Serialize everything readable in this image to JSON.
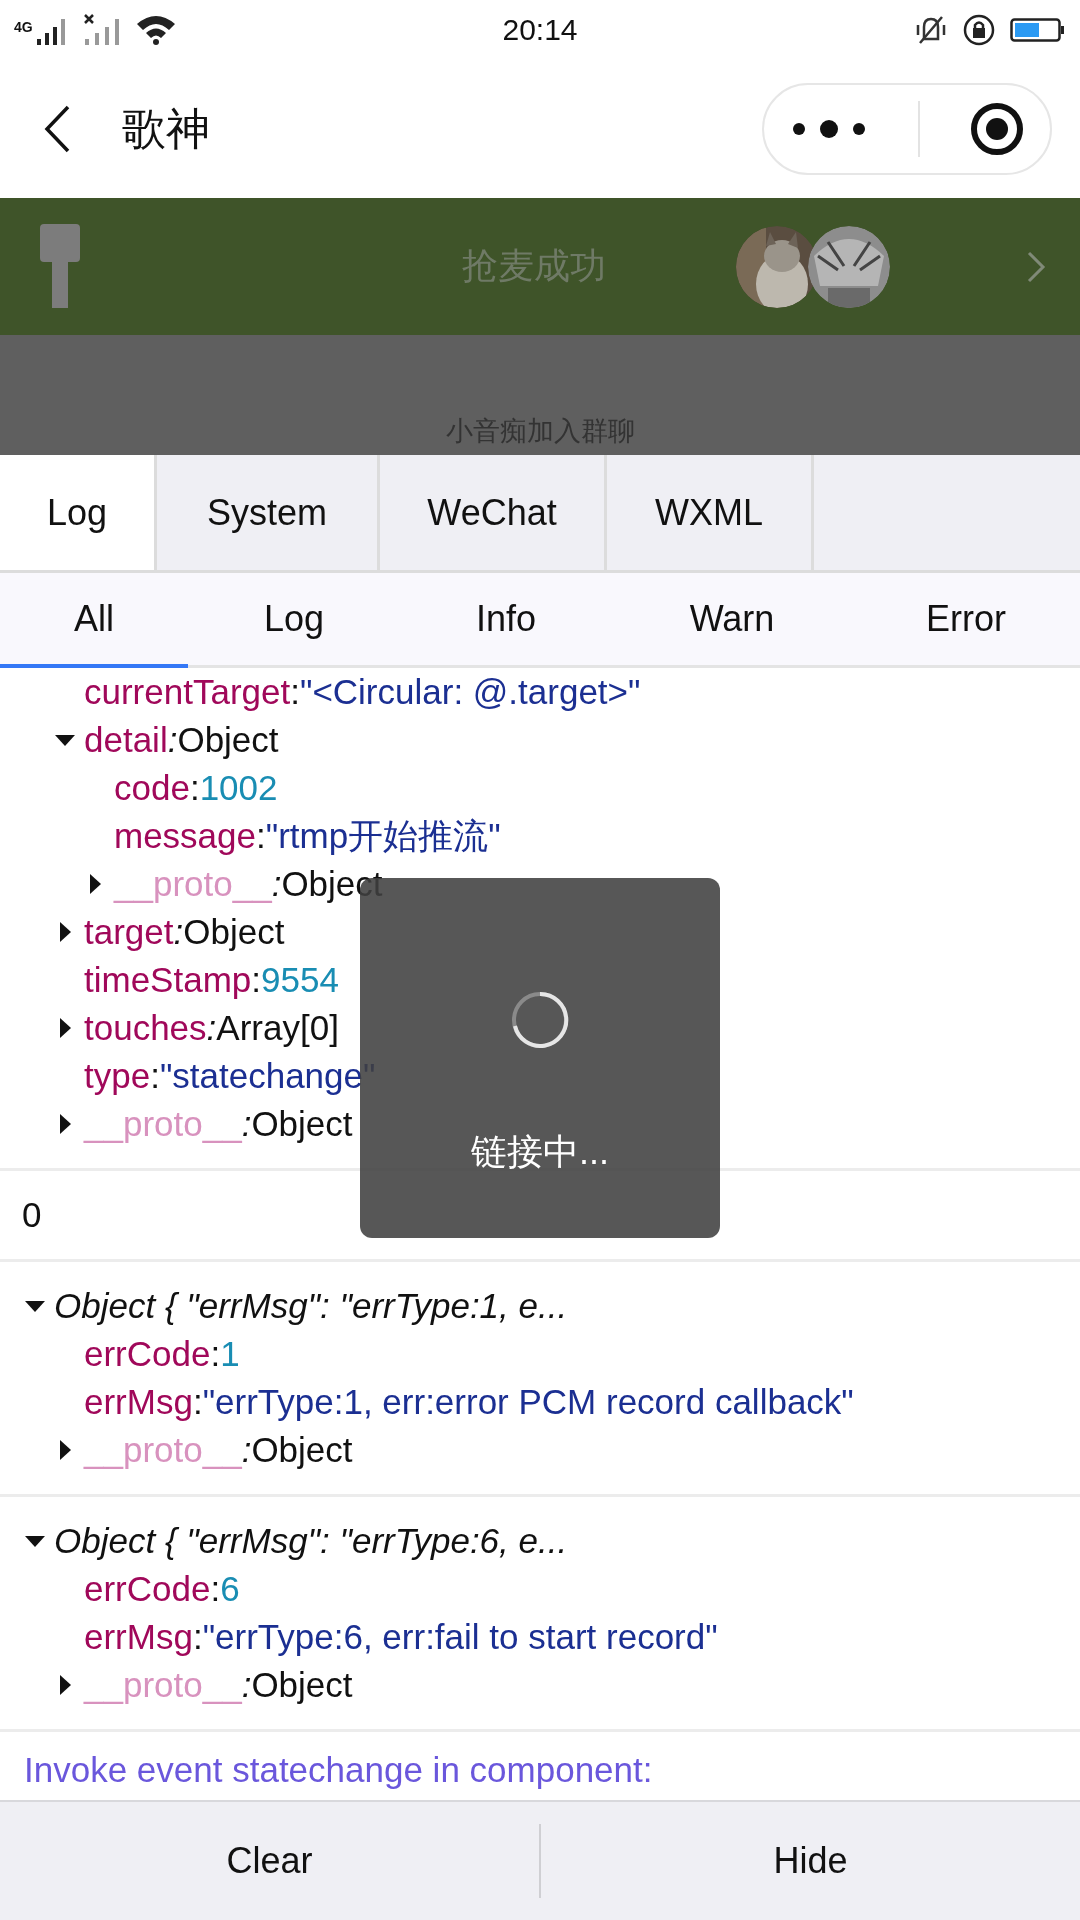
{
  "status_bar": {
    "network": "4G",
    "time": "20:14"
  },
  "nav": {
    "title": "歌神"
  },
  "banner": {
    "title": "抢麦成功"
  },
  "notice": "小音痴加入群聊",
  "tabs": [
    {
      "label": "Log",
      "selected": true
    },
    {
      "label": "System",
      "selected": false
    },
    {
      "label": "WeChat",
      "selected": false
    },
    {
      "label": "WXML",
      "selected": false
    }
  ],
  "filters": [
    {
      "label": "All",
      "selected": true
    },
    {
      "label": "Log",
      "selected": false
    },
    {
      "label": "Info",
      "selected": false
    },
    {
      "label": "Warn",
      "selected": false
    },
    {
      "label": "Error",
      "selected": false
    }
  ],
  "log_entries": [
    {
      "kind": "tree",
      "children": [
        {
          "key": "currentTarget",
          "sep": ":",
          "value": "\"<Circular: @.target>\"",
          "kind": "string"
        },
        {
          "key": "detail",
          "sep": ":",
          "value": "Object",
          "kind": "object",
          "expanded": true,
          "children": [
            {
              "key": "code",
              "sep": ":",
              "value": "1002",
              "kind": "number"
            },
            {
              "key": "message",
              "sep": ":",
              "value": "\"rtmp开始推流\"",
              "kind": "string"
            },
            {
              "key": "__proto__",
              "sep": ":",
              "value": "Object",
              "kind": "proto",
              "expanded": false
            }
          ]
        },
        {
          "key": "target",
          "sep": ":",
          "value": "Object",
          "kind": "object",
          "expanded": false
        },
        {
          "key": "timeStamp",
          "sep": ":",
          "value": "9554",
          "kind": "number"
        },
        {
          "key": "touches",
          "sep": ":",
          "value": "Array[0]",
          "kind": "object",
          "expanded": false
        },
        {
          "key": "type",
          "sep": ":",
          "value": "\"statechange\"",
          "kind": "string"
        },
        {
          "key": "__proto__",
          "sep": ":",
          "value": "Object",
          "kind": "proto",
          "expanded": false
        }
      ]
    },
    {
      "kind": "plain",
      "text": "0"
    },
    {
      "kind": "object",
      "summary": "Object { \"errMsg\": \"errType:1, e...",
      "expanded": true,
      "children": [
        {
          "key": "errCode",
          "sep": ":",
          "value": "1",
          "kind": "number"
        },
        {
          "key": "errMsg",
          "sep": ":",
          "value": "\"errType:1, err:error PCM record callback\"",
          "kind": "string"
        },
        {
          "key": "__proto__",
          "sep": ":",
          "value": "Object",
          "kind": "proto",
          "expanded": false
        }
      ]
    },
    {
      "kind": "object",
      "summary": "Object { \"errMsg\": \"errType:6, e...",
      "expanded": true,
      "children": [
        {
          "key": "errCode",
          "sep": ":",
          "value": "6",
          "kind": "number"
        },
        {
          "key": "errMsg",
          "sep": ":",
          "value": "\"errType:6, err:fail to start record\"",
          "kind": "string"
        },
        {
          "key": "__proto__",
          "sep": ":",
          "value": "Object",
          "kind": "proto",
          "expanded": false
        }
      ]
    },
    {
      "kind": "event",
      "text": "Invoke event statechange in component:"
    }
  ],
  "toast": {
    "text": "链接中..."
  },
  "bottom_buttons": [
    "Clear",
    "Hide"
  ]
}
